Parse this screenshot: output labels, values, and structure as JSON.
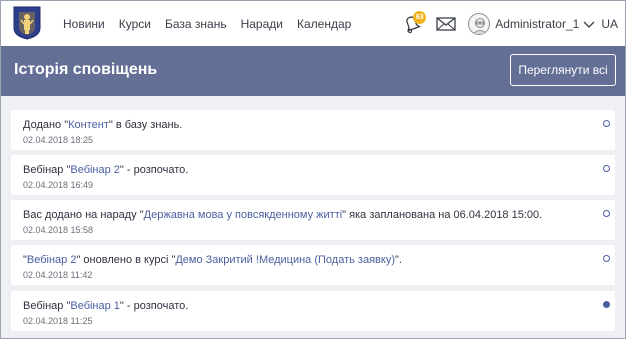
{
  "nav": {
    "items": [
      "Новини",
      "Курси",
      "База знань",
      "Наради",
      "Календар"
    ]
  },
  "tools": {
    "notifications_count": "63",
    "username": "Administrator_1",
    "language": "UA"
  },
  "header": {
    "title": "Історія сповіщень",
    "view_all_label": "Переглянути всі"
  },
  "notifications": [
    {
      "prefix": "Додано \"",
      "link1": "Контент",
      "middle": "\" в базу знань.",
      "link2": "",
      "suffix": "",
      "date": "02.04.2018 18:25",
      "read": true
    },
    {
      "prefix": "Вебінар \"",
      "link1": "Вебінар 2",
      "middle": "\" - розпочато.",
      "link2": "",
      "suffix": "",
      "date": "02.04.2018 16:49",
      "read": true
    },
    {
      "prefix": "Вас додано на нараду \"",
      "link1": "Державна мова у повсякденному житті",
      "middle": "\" яка запланована на 06.04.2018 15:00.",
      "link2": "",
      "suffix": "",
      "date": "02.04.2018 15:58",
      "read": true
    },
    {
      "prefix": "\"",
      "link1": "Вебінар 2",
      "middle": "\" оновлено в курсі \"",
      "link2": "Демо Закритий !Медицина (Подать заявку)",
      "suffix": "\".",
      "date": "02.04.2018 11:42",
      "read": true
    },
    {
      "prefix": "Вебінар \"",
      "link1": "Вебінар 1",
      "middle": "\" - розпочато.",
      "link2": "",
      "suffix": "",
      "date": "02.04.2018 11:25",
      "read": false
    }
  ],
  "colors": {
    "header_bg": "#646f96",
    "link": "#4a5fa0",
    "badge": "#f2b21b",
    "list_bg": "#eef0f4"
  }
}
